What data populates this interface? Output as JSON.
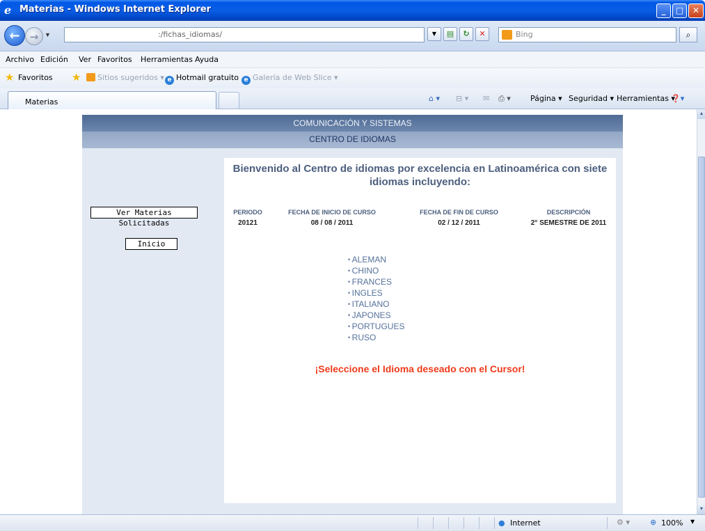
{
  "window": {
    "title": "Materias - Windows Internet Explorer"
  },
  "address": {
    "url": ":/fichas_idiomas/",
    "search_placeholder": "Bing"
  },
  "menu": [
    "Archivo",
    "Edición",
    "Ver",
    "Favoritos",
    "Herramientas",
    "Ayuda"
  ],
  "favbar": {
    "favorites": "Favoritos",
    "suggested": "Sitios sugeridos",
    "hotmail": "Hotmail gratuito",
    "webslice": "Galería de Web Slice"
  },
  "tab": {
    "title": "Materias"
  },
  "commandbar": {
    "page": "Página",
    "security": "Seguridad",
    "tools": "Herramientas"
  },
  "site": {
    "header": "COMUNICACIÓN Y SISTEMAS",
    "subheader": "CENTRO DE IDIOMAS",
    "buttons": {
      "ver_materias": "Ver Materias Solicitadas",
      "inicio": "Inicio"
    },
    "welcome": "Bienvenido al Centro de idiomas por excelencia en Latinoamérica con siete idiomas incluyendo:",
    "table": {
      "headers": [
        "PERIODO",
        "FECHA DE INICIO DE CURSO",
        "FECHA DE FIN DE CURSO",
        "DESCRIPCIÓN"
      ],
      "values": [
        "20121",
        "08 / 08 / 2011",
        "02 / 12 / 2011",
        "2° SEMESTRE DE 2011"
      ]
    },
    "languages": [
      "ALEMAN",
      "CHINO",
      "FRANCES",
      "INGLES",
      "ITALIANO",
      "JAPONES",
      "PORTUGUES",
      "RUSO"
    ],
    "cta": "¡Seleccione el Idioma deseado con el Cursor!"
  },
  "status": {
    "zone": "Internet",
    "zoom": "100%"
  },
  "colors": {
    "accent": "#ee3b1b",
    "banner": "#4e6b94",
    "panel": "#e3e9f3"
  }
}
